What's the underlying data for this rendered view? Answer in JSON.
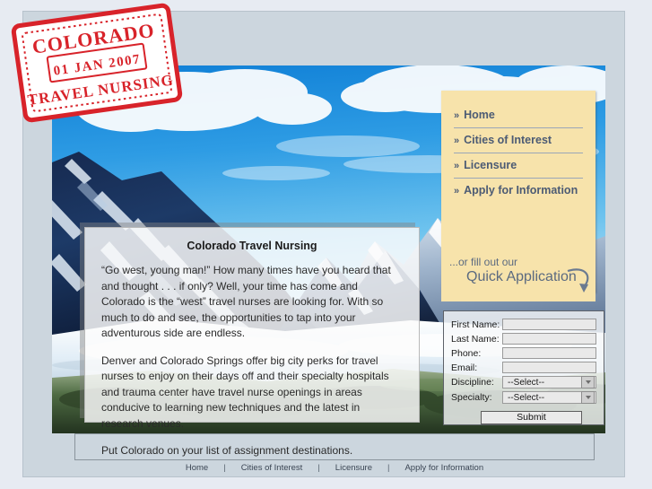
{
  "stamp": {
    "line_top": "COLORADO",
    "line_mid": "01 JAN 2007",
    "line_bottom": "TRAVEL NURSING",
    "color": "#d8232a"
  },
  "nav": {
    "chevron": "»",
    "items": [
      {
        "label": "Home"
      },
      {
        "label": "Cities of Interest"
      },
      {
        "label": "Licensure"
      },
      {
        "label": "Apply for Information"
      }
    ]
  },
  "quick_application": {
    "line1": "...or fill out our",
    "line2": "Quick Application"
  },
  "content": {
    "title": "Colorado Travel Nursing",
    "paragraphs": [
      "“Go west, young man!”  How many times have you heard that and thought . . . if only?  Well, your time has come and Colorado is the “west” travel nurses are looking for.  With so much to do and see, the opportunities to tap into your adventurous side are endless.",
      "Denver and Colorado Springs offer big city perks for travel nurses to enjoy on their days off and their specialty hospitals and trauma center have travel nurse openings in areas conducive to learning new techniques and the latest in research venues.",
      "Put Colorado on your list of assignment destinations."
    ]
  },
  "form": {
    "fields": [
      {
        "label": "First Name:",
        "value": "",
        "type": "text"
      },
      {
        "label": "Last Name:",
        "value": "",
        "type": "text"
      },
      {
        "label": "Phone:",
        "value": "",
        "type": "text"
      },
      {
        "label": "Email:",
        "value": "",
        "type": "text"
      },
      {
        "label": "Discipline:",
        "value": "--Select--",
        "type": "select"
      },
      {
        "label": "Specialty:",
        "value": "--Select--",
        "type": "select"
      }
    ],
    "submit_label": "Submit"
  },
  "footer": {
    "separator": "|",
    "links": [
      {
        "label": "Home"
      },
      {
        "label": "Cities of Interest"
      },
      {
        "label": "Licensure"
      },
      {
        "label": "Apply for Information"
      }
    ]
  },
  "theme": {
    "page_background": "#e7ebf2",
    "frame_background": "#ccd6de",
    "nav_panel_background": "#f7e3ab",
    "nav_text": "#4c5b74",
    "stamp_red": "#d8232a"
  }
}
